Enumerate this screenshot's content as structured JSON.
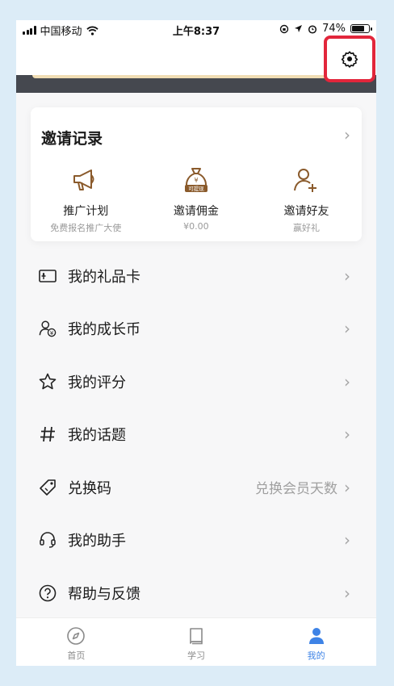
{
  "status_bar": {
    "carrier": "中国移动",
    "time": "上午8:37",
    "battery": "74%",
    "battery_level": 0.74
  },
  "invite": {
    "title": "邀请记录",
    "items": [
      {
        "label": "推广计划",
        "sub": "免费报名推广大使",
        "icon": "megaphone-icon"
      },
      {
        "label": "邀请佣金",
        "sub": "¥0.00",
        "icon": "money-bag-icon",
        "badge": "可提现"
      },
      {
        "label": "邀请好友",
        "sub": "赢好礼",
        "icon": "add-user-icon"
      }
    ]
  },
  "menu": [
    {
      "label": "我的礼品卡",
      "icon": "gift-card-icon",
      "right": ""
    },
    {
      "label": "我的成长币",
      "icon": "growth-coin-icon",
      "right": ""
    },
    {
      "label": "我的评分",
      "icon": "star-icon",
      "right": ""
    },
    {
      "label": "我的话题",
      "icon": "hashtag-icon",
      "right": ""
    },
    {
      "label": "兑换码",
      "icon": "tag-icon",
      "right": "兑换会员天数"
    },
    {
      "label": "我的助手",
      "icon": "headset-icon",
      "right": ""
    },
    {
      "label": "帮助与反馈",
      "icon": "help-icon",
      "right": ""
    }
  ],
  "tabs": [
    {
      "label": "首页",
      "icon": "compass-icon",
      "active": false
    },
    {
      "label": "学习",
      "icon": "book-icon",
      "active": false
    },
    {
      "label": "我的",
      "icon": "profile-icon",
      "active": true
    }
  ],
  "colors": {
    "accent": "#3e83e6",
    "brown": "#8a5a2b",
    "highlight": "#e2263b",
    "dark_band": "#45484f"
  }
}
